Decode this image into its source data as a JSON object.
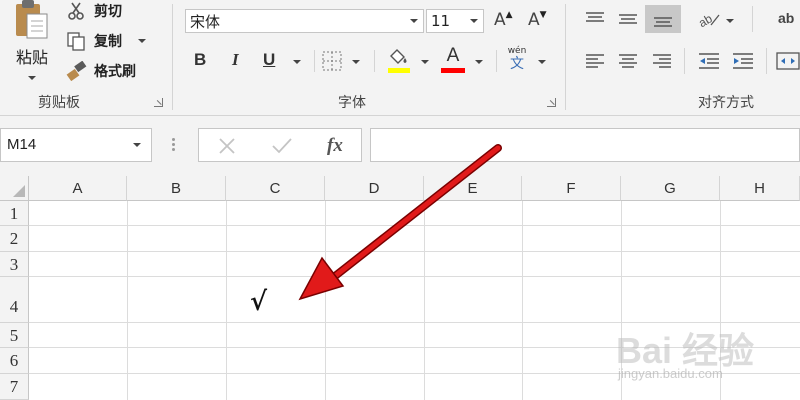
{
  "ribbon": {
    "clipboard": {
      "paste_label": "粘贴",
      "cut_label": "剪切",
      "copy_label": "复制",
      "format_painter_label": "格式刷",
      "group_label": "剪贴板"
    },
    "font": {
      "font_name": "宋体",
      "font_size": "11",
      "bold": "B",
      "italic": "I",
      "underline": "U",
      "font_color_letter": "A",
      "phonetic_top": "wén",
      "phonetic_bottom": "文",
      "group_label": "字体",
      "grow_letter": "A",
      "shrink_letter": "A"
    },
    "alignment": {
      "group_label": "对齐方式",
      "wrap_partial": "ab"
    }
  },
  "formula_bar": {
    "name_box": "M14",
    "fx_label": "fx",
    "formula_value": ""
  },
  "sheet": {
    "columns": [
      "A",
      "B",
      "C",
      "D",
      "E",
      "F",
      "G",
      "H"
    ],
    "rows": [
      "1",
      "2",
      "3",
      "4",
      "5",
      "6",
      "7"
    ],
    "cell_c4_value": "√"
  },
  "colors": {
    "arrow": "#e11a1a",
    "highlight_bar": "#ffff00",
    "font_color_bar": "#ff0000"
  },
  "watermark": {
    "main": "Bai 经验",
    "url": "jingyan.baidu.com"
  }
}
